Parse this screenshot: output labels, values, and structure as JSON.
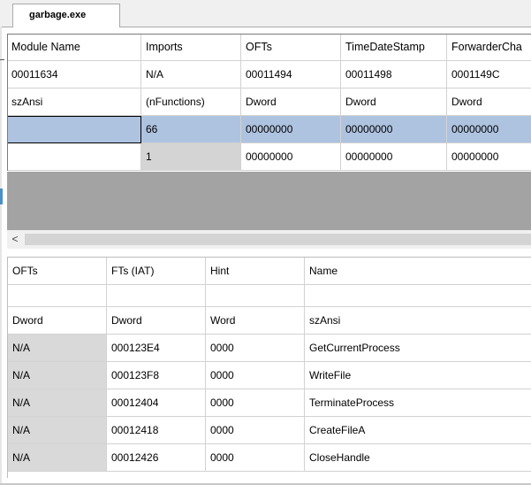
{
  "tab": {
    "label": "garbage.exe"
  },
  "top_table": {
    "headers": [
      "Module Name",
      "Imports",
      "OFTs",
      "TimeDateStamp",
      "ForwarderCha"
    ],
    "rows": [
      [
        "00011634",
        "N/A",
        "00011494",
        "00011498",
        "0001149C"
      ],
      [
        "szAnsi",
        "(nFunctions)",
        "Dword",
        "Dword",
        "Dword"
      ],
      [
        "",
        "66",
        "00000000",
        "00000000",
        "00000000"
      ],
      [
        "",
        "1",
        "00000000",
        "00000000",
        "00000000"
      ]
    ]
  },
  "scroll": {
    "left_arrow": "<"
  },
  "bottom_table": {
    "headers": [
      "OFTs",
      "FTs (IAT)",
      "Hint",
      "Name"
    ],
    "blank_row": [
      "",
      "",
      "",
      ""
    ],
    "type_row": [
      "Dword",
      "Dword",
      "Word",
      "szAnsi"
    ],
    "rows": [
      [
        "N/A",
        "000123E4",
        "0000",
        "GetCurrentProcess"
      ],
      [
        "N/A",
        "000123F8",
        "0000",
        "WriteFile"
      ],
      [
        "N/A",
        "00012404",
        "0000",
        "TerminateProcess"
      ],
      [
        "N/A",
        "00012418",
        "0000",
        "CreateFileA"
      ],
      [
        "N/A",
        "00012426",
        "0000",
        "CloseHandle"
      ]
    ]
  },
  "colors": {
    "selection": "#aec3e0",
    "gray_area": "#a3a3a3",
    "cell_grey": "#d4d4d4"
  }
}
